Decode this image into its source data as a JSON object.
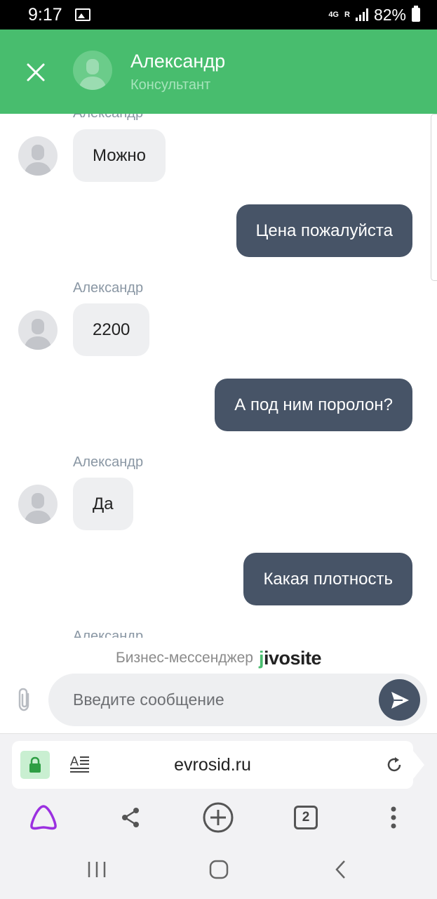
{
  "status_bar": {
    "time": "9:17",
    "network": "4G",
    "roaming": "R",
    "battery": "82%"
  },
  "chat_header": {
    "agent_name": "Александр",
    "agent_role": "Консультант"
  },
  "messages": [
    {
      "from": "agent",
      "sender": "Александр",
      "text": "Можно"
    },
    {
      "from": "user",
      "text": "Цена пожалуйста"
    },
    {
      "from": "agent",
      "sender": "Александр",
      "text": "2200"
    },
    {
      "from": "user",
      "text": "А под ним поролон?"
    },
    {
      "from": "agent",
      "sender": "Александр",
      "text": "Да"
    },
    {
      "from": "user",
      "text": "Какая плотность"
    },
    {
      "from": "agent",
      "sender": "Александр"
    }
  ],
  "branding": {
    "text": "Бизнес-мессенджер",
    "logo": "jivosite"
  },
  "composer": {
    "placeholder": "Введите сообщение"
  },
  "browser": {
    "url": "evrosid.ru",
    "tab_count": "2"
  },
  "colors": {
    "header_green": "#48bd6e",
    "outgoing_bubble": "#475467",
    "incoming_bubble": "#eeeff1",
    "sender_name": "#8a97a4"
  }
}
